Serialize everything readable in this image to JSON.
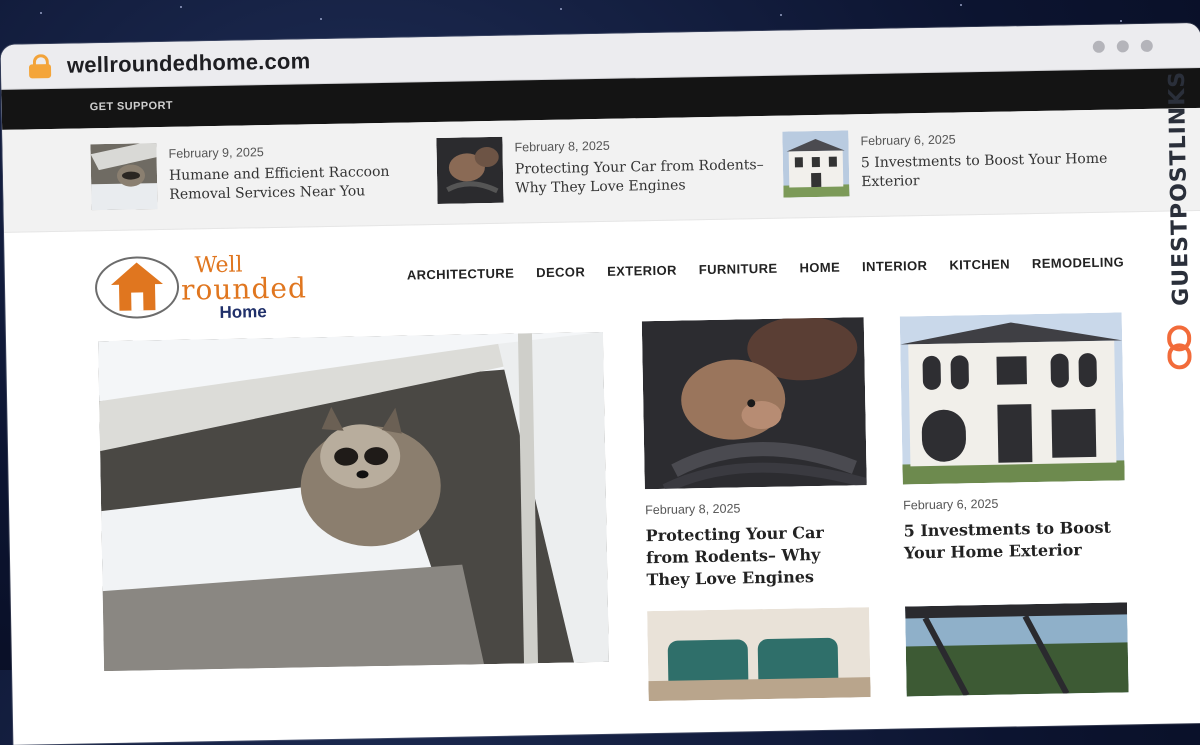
{
  "browser": {
    "url": "wellroundedhome.com"
  },
  "topbar": {
    "support_label": "GET SUPPORT"
  },
  "ticker": [
    {
      "date": "February 9, 2025",
      "title": "Humane and Efficient Raccoon Removal Services Near You"
    },
    {
      "date": "February 8, 2025",
      "title": "Protecting Your Car from Rodents– Why They Love Engines"
    },
    {
      "date": "February 6, 2025",
      "title": "5 Investments to Boost Your Home Exterior"
    }
  ],
  "logo": {
    "line1": "Well",
    "line2": "rounded",
    "line3": "Home"
  },
  "nav": [
    "ARCHITECTURE",
    "DECOR",
    "EXTERIOR",
    "FURNITURE",
    "HOME",
    "INTERIOR",
    "KITCHEN",
    "REMODELING"
  ],
  "cards": [
    {
      "date": "February 8, 2025",
      "title": "Protecting Your Car from Rodents– Why They Love Engines"
    },
    {
      "date": "February 6, 2025",
      "title": "5 Investments to Boost Your Home Exterior"
    }
  ],
  "side_brand": {
    "text": "GUESTPOSTLINKS",
    "accent": "#f26b3a"
  },
  "colors": {
    "brand_orange": "#e0761f",
    "brand_navy": "#20306a",
    "topbar": "#141414"
  }
}
